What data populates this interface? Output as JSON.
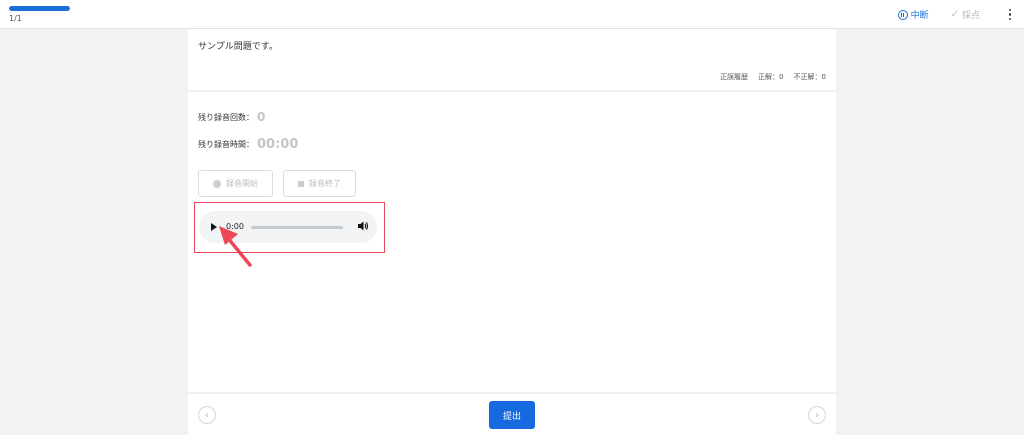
{
  "header": {
    "progress_fraction": 1.0,
    "page_count": "1/1",
    "pause_label": "中断",
    "grade_label": "採点"
  },
  "question": {
    "text": "サンプル問題です。",
    "history_label": "正誤履歴",
    "correct_label": "正解：0",
    "incorrect_label": "不正解：0"
  },
  "recording": {
    "remaining_count_label": "残り録音回数：",
    "remaining_count_value": "0",
    "remaining_time_label": "残り録音時間：",
    "remaining_time_value": "00:00",
    "start_label": "録音開始",
    "stop_label": "録音終了"
  },
  "audio": {
    "current_time": "0:00"
  },
  "footer": {
    "submit_label": "提出",
    "prev_glyph": "‹",
    "next_glyph": "›"
  },
  "colors": {
    "accent": "#1b6fd8",
    "highlight": "#e54b5a"
  },
  "icons": [
    "pause-icon",
    "check-icon",
    "more-vert-icon",
    "record-dot-icon",
    "stop-square-icon",
    "play-icon",
    "volume-icon",
    "chevron-left-icon",
    "chevron-right-icon"
  ]
}
